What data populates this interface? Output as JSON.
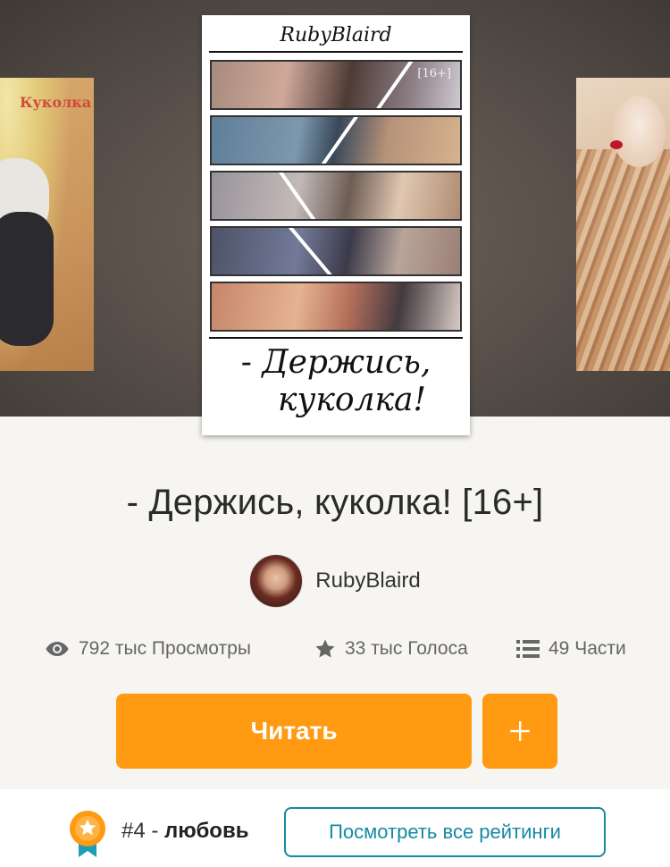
{
  "side_left_cover": {
    "title": "Куколка"
  },
  "cover": {
    "author": "RubyBlaird",
    "badge": "[16+]",
    "title_line1": "- Держись,",
    "title_line2": "куколка!"
  },
  "story": {
    "title": "- Держись, куколка! [16+]",
    "author": "RubyBlaird"
  },
  "stats": {
    "views": "792 тыс Просмотры",
    "votes": "33 тыс Голоса",
    "parts": "49 Части"
  },
  "actions": {
    "read_label": "Читать",
    "add_label": "+"
  },
  "ranking": {
    "rank": "#4",
    "separator": " - ",
    "category": "любовь",
    "all_ratings_label": "Посмотреть все рейтинги"
  },
  "colors": {
    "accent": "#ff9a12",
    "link": "#168aa3"
  }
}
